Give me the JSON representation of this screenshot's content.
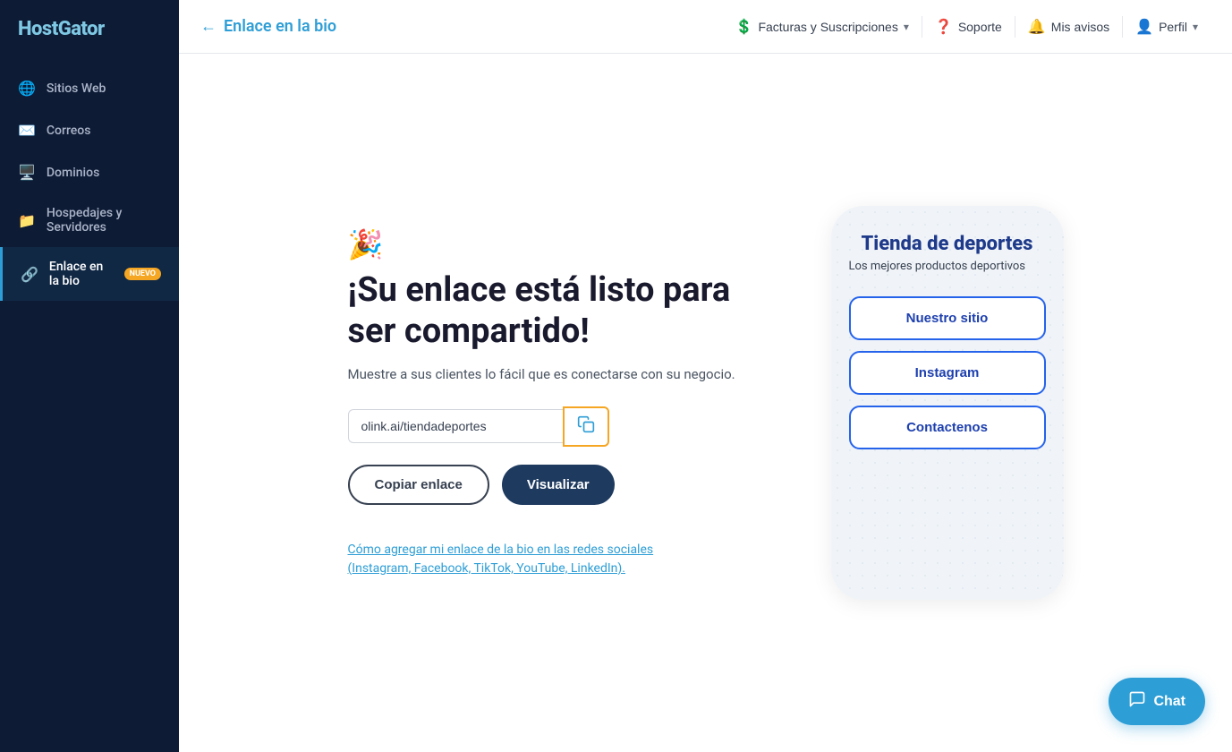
{
  "sidebar": {
    "logo": "HostGator",
    "items": [
      {
        "id": "sitios-web",
        "label": "Sitios Web",
        "icon": "🌐",
        "active": false
      },
      {
        "id": "correos",
        "label": "Correos",
        "icon": "✉️",
        "active": false
      },
      {
        "id": "dominios",
        "label": "Dominios",
        "icon": "🖥️",
        "active": false
      },
      {
        "id": "hospedajes",
        "label": "Hospedajes y Servidores",
        "icon": "📁",
        "active": false
      },
      {
        "id": "enlace-bio",
        "label": "Enlace en la bio",
        "icon": "🔗",
        "active": true,
        "badge": "NUEVO"
      }
    ]
  },
  "topbar": {
    "back_label": "Enlace en la bio",
    "billing_label": "Facturas y Suscripciones",
    "support_label": "Soporte",
    "notices_label": "Mis avisos",
    "profile_label": "Perfil"
  },
  "main": {
    "party_emoji": "🎉",
    "title": "¡Su enlace está listo para ser compartido!",
    "subtitle": "Muestre a sus clientes lo fácil que es conectarse con su negocio.",
    "url_value": "olink.ai/tiendadeportes",
    "copy_link_label": "Copiar enlace",
    "visualize_label": "Visualizar",
    "info_link_label": "Cómo agregar mi enlace de la bio en las redes sociales (Instagram, Facebook, TikTok, YouTube, LinkedIn)."
  },
  "phone_preview": {
    "title": "Tienda de deportes",
    "subtitle": "Los mejores productos deportivos",
    "buttons": [
      {
        "label": "Nuestro sitio"
      },
      {
        "label": "Instagram"
      },
      {
        "label": "Contactenos"
      }
    ]
  },
  "chat": {
    "label": "Chat"
  }
}
